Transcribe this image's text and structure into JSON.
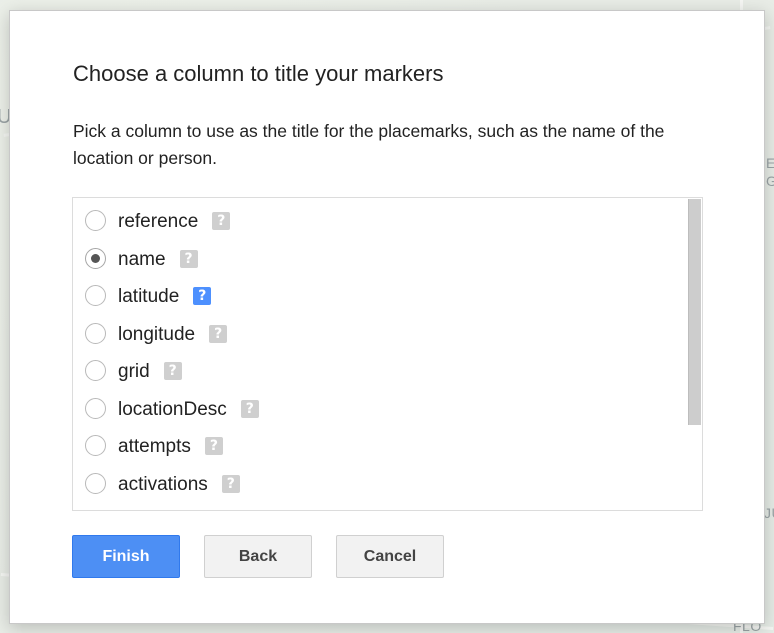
{
  "background_map": {
    "labels": [
      "U",
      "E",
      "G",
      "JU",
      "FLO"
    ]
  },
  "dialog": {
    "title": "Choose a column to title your markers",
    "description": "Pick a column to use as the title for the placemarks, such as the name of the location or person.",
    "columns": [
      {
        "label": "reference",
        "checked": false,
        "help_icon": "help-icon",
        "help_active": false
      },
      {
        "label": "name",
        "checked": true,
        "help_icon": "help-icon",
        "help_active": false
      },
      {
        "label": "latitude",
        "checked": false,
        "help_icon": "help-icon",
        "help_active": true
      },
      {
        "label": "longitude",
        "checked": false,
        "help_icon": "help-icon",
        "help_active": false
      },
      {
        "label": "grid",
        "checked": false,
        "help_icon": "help-icon",
        "help_active": false
      },
      {
        "label": "locationDesc",
        "checked": false,
        "help_icon": "help-icon",
        "help_active": false
      },
      {
        "label": "attempts",
        "checked": false,
        "help_icon": "help-icon",
        "help_active": false
      },
      {
        "label": "activations",
        "checked": false,
        "help_icon": "help-icon",
        "help_active": false
      }
    ],
    "help_glyph": "?",
    "buttons": {
      "finish": "Finish",
      "back": "Back",
      "cancel": "Cancel"
    }
  },
  "colors": {
    "primary_button": "#4d8ff4",
    "help_active": "#4d90fe",
    "help_inactive": "#cfcfcf"
  }
}
